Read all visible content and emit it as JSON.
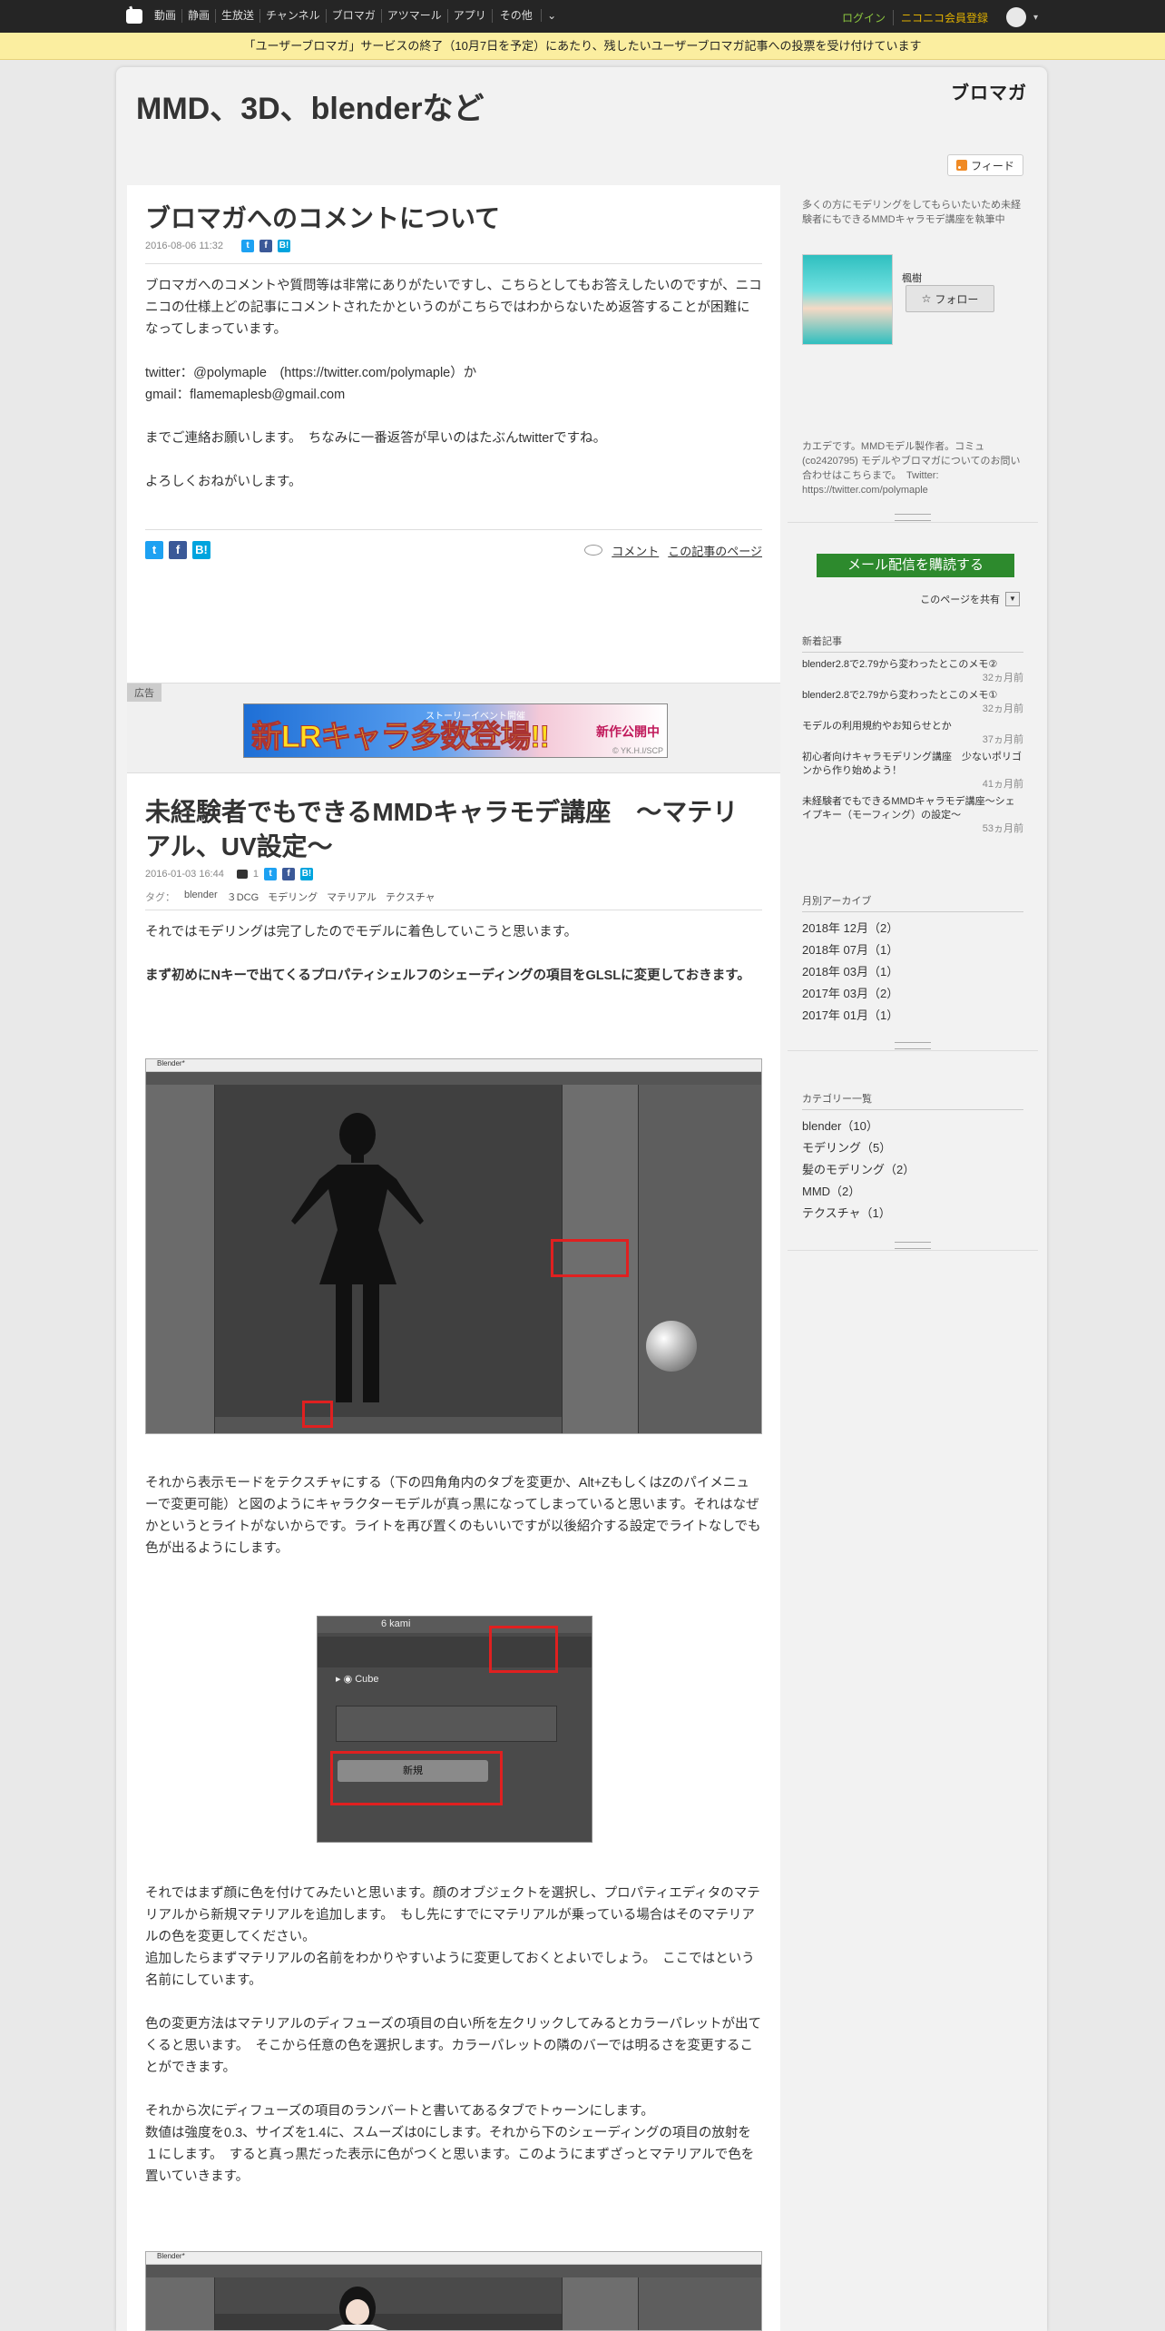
{
  "nav": {
    "links": [
      "動画",
      "静画",
      "生放送",
      "チャンネル",
      "ブロマガ",
      "アツマール",
      "アプリ",
      "その他"
    ],
    "login": "ログイン",
    "register": "ニコニコ会員登録"
  },
  "notice": "「ユーザーブロマガ」サービスの終了（10月7日を予定）にあたり、残したいユーザーブロマガ記事への投票を受け付けています",
  "blog": {
    "title": "MMD、3D、blenderなど",
    "logo": "ブロマガ",
    "feed": "フィード"
  },
  "article1": {
    "title": "ブロマガへのコメントについて",
    "date": "2016-08-06 11:32",
    "paragraphs": [
      "ブロマガへのコメントや質問等は非常にありがたいですし、こちらとしてもお答えしたいのですが、ニコニコの仕様上どの記事にコメントされたかというのがこちらではわからないため返答することが困難になってしまっています。",
      "twitter：@polymaple　(https://twitter.com/polymaple）か",
      "gmail：flamemaplesb@gmail.com",
      "までご連絡お願いします。　ちなみに一番返答が早いのはたぶんtwitterですね。",
      "よろしくおねがいします。"
    ],
    "comment_link": "コメント",
    "page_link": "この記事のページ"
  },
  "ad": {
    "label": "広告",
    "banner_big": "新LRキャラ多数登場!!",
    "banner_small": "ストーリーイベント開催",
    "banner_right": "新作公開中",
    "banner_copy": "© YK.H.I/SCP"
  },
  "article2": {
    "title": "未経験者でもできるMMDキャラモデ講座　～マテリアル、UV設定～",
    "date": "2016-01-03 16:44",
    "comments": "1",
    "tags_label": "タグ：",
    "tags": [
      "blender",
      "３DCG",
      "モデリング",
      "マテリアル",
      "テクスチャ"
    ],
    "p1": "それではモデリングは完了したのでモデルに着色していこうと思います。",
    "p2": "まず初めにNキーで出てくるプロパティシェルフのシェーディングの項目をGLSLに変更しておきます。",
    "p3": "それから表示モードをテクスチャにする（下の四角角内のタブを変更か、Alt+ZもしくはZのパイメニューで変更可能）と図のようにキャラクターモデルが真っ黒になってしまっていると思います。それはなぜかというとライトがないからです。ライトを再び置くのもいいですが以後紹介する設定でライトなしでも色が出るようにします。",
    "fig2_cube": "Cube",
    "fig2_new": "新規",
    "fig2_kami": "6 kami",
    "p4": "それではまず顔に色を付けてみたいと思います。顔のオブジェクトを選択し、プロパティエディタのマテリアルから新規マテリアルを追加します。　もし先にすでにマテリアルが乗っている場合はそのマテリアルの色を変更してください。",
    "p5": "追加したらまずマテリアルの名前をわかりやすいように変更しておくとよいでしょう。　ここではという名前にしています。",
    "p6": "色の変更方法はマテリアルのディフューズの項目の白い所を左クリックしてみるとカラーパレットが出てくると思います。　そこから任意の色を選択します。カラーパレットの隣のバーでは明るさを変更することができます。",
    "p7": "それから次にディフューズの項目のランバートと書いてあるタブでトゥーンにします。",
    "p8": "数値は強度を0.3、サイズを1.4に、スムーズは0にします。それから下のシェーディングの項目の放射を１にします。　すると真っ黒だった表示に色がつくと思います。このようにまずざっとマテリアルで色を置いていきます。",
    "fig_title": "Blender*"
  },
  "sidebar": {
    "blog_desc": "多くの方にモデリングをしてもらいたいため未経験者にもできるMMDキャラモデ講座を執筆中",
    "author": "楓樹",
    "follow": "フォロー",
    "author_desc": "カエデです。MMDモデル製作者。コミュ(co2420795) モデルやブロマガについてのお問い合わせはこちらまで。　Twitter: https://twitter.com/polymaple",
    "mail_btn": "メール配信を購読する",
    "share": "このページを共有",
    "recent_title": "新着記事",
    "recent": [
      {
        "title": "blender2.8で2.79から変わったとこのメモ②",
        "ago": "32ヵ月前"
      },
      {
        "title": "blender2.8で2.79から変わったとこのメモ①",
        "ago": "32ヵ月前"
      },
      {
        "title": "モデルの利用規約やお知らせとか",
        "ago": "37ヵ月前"
      },
      {
        "title": "初心者向けキャラモデリング講座　少ないポリゴンから作り始めよう！",
        "ago": "41ヵ月前"
      },
      {
        "title": "未経験者でもできるMMDキャラモデ講座～シェイプキー（モーフィング）の設定～",
        "ago": "53ヵ月前"
      }
    ],
    "archive_title": "月別アーカイブ",
    "archive": [
      "2018年 12月（2）",
      "2018年 07月（1）",
      "2018年 03月（1）",
      "2017年 03月（2）",
      "2017年 01月（1）"
    ],
    "category_title": "カテゴリー一覧",
    "categories": [
      "blender（10）",
      "モデリング（5）",
      "髪のモデリング（2）",
      "MMD（2）",
      "テクスチャ（1）"
    ]
  },
  "colors": {
    "nav_bg": "#252525",
    "notice_bg": "#fbeea0",
    "mail_btn": "#2d8a2d",
    "highlight_box": "#e02020"
  }
}
